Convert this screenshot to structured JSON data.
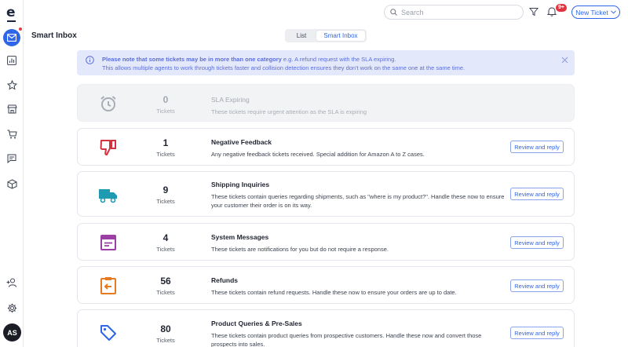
{
  "app": {
    "logo": "e",
    "avatar_initials": "AS"
  },
  "header": {
    "search_placeholder": "Search",
    "notification_badge": "9+",
    "new_ticket_label": "New Ticket"
  },
  "page": {
    "title": "Smart Inbox",
    "view_toggle": {
      "list_label": "List",
      "smart_label": "Smart Inbox",
      "active": "Smart Inbox"
    }
  },
  "notice": {
    "bold_text": "Please note that some tickets may be in more than one category",
    "text": " e.g. A refund request with the SLA expiring.",
    "line2": "This allows multiple agents to work through tickets faster and collision detection ensures they don't work on the same one at the same time."
  },
  "categories": [
    {
      "count": "0",
      "count_label": "Tickets",
      "title": "SLA Expiring",
      "description": "These tickets require urgent attention as the SLA is expiring",
      "icon": "alarm-clock-icon",
      "color": "#a8adb6",
      "disabled": true
    },
    {
      "count": "1",
      "count_label": "Tickets",
      "title": "Negative Feedback",
      "description": "Any negative feedback tickets received. Special addition for Amazon A to Z cases.",
      "icon": "thumbs-down-icon",
      "color": "#d3313f",
      "button": "Review and reply"
    },
    {
      "count": "9",
      "count_label": "Tickets",
      "title": "Shipping Inquiries",
      "description": "These tickets contain queries regarding shipments, such as \"where is my product?\". Handle these now to ensure your customer their order is on its way.",
      "icon": "truck-icon",
      "color": "#1f9bb1",
      "button": "Review and reply"
    },
    {
      "count": "4",
      "count_label": "Tickets",
      "title": "System Messages",
      "description": "These tickets are notifications for you but do not require a response.",
      "icon": "message-window-icon",
      "color": "#9c3fa5",
      "button": "Review and reply"
    },
    {
      "count": "56",
      "count_label": "Tickets",
      "title": "Refunds",
      "description": "These tickets contain refund requests. Handle these now to ensure your orders are up to date.",
      "icon": "refund-icon",
      "color": "#e67a22",
      "button": "Review and reply"
    },
    {
      "count": "80",
      "count_label": "Tickets",
      "title": "Product Queries & Pre-Sales",
      "description": "These tickets contain product queries from prospective customers. Handle these now and convert those prospects into sales.",
      "icon": "price-tag-icon",
      "color": "#2f66e8",
      "button": "Review and reply"
    }
  ],
  "sidebar": {
    "items": [
      "inbox-icon",
      "analytics-icon",
      "star-icon",
      "store-icon",
      "cart-icon",
      "chat-icon",
      "box-icon",
      "add-user-icon",
      "settings-icon"
    ]
  },
  "colors": {
    "accent": "#2f66e8",
    "notice_bg": "#e4e8fb",
    "badge": "#e0323f"
  }
}
